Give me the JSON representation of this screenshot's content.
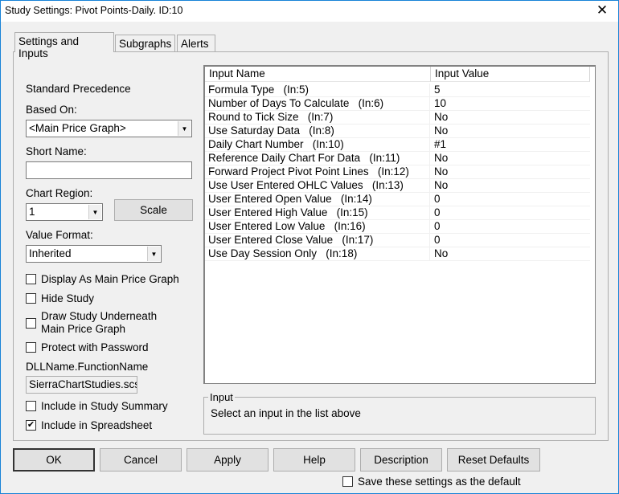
{
  "window": {
    "title": "Study Settings: Pivot Points-Daily. ID:10",
    "close": "✕"
  },
  "tabs": [
    "Settings and Inputs",
    "Subgraphs",
    "Alerts"
  ],
  "left": {
    "standard_precedence": "Standard Precedence",
    "based_on_label": "Based On:",
    "based_on_value": "<Main Price Graph>",
    "short_name_label": "Short Name:",
    "short_name_value": "",
    "chart_region_label": "Chart Region:",
    "chart_region_value": "1",
    "scale_button": "Scale",
    "value_format_label": "Value Format:",
    "value_format_value": "Inherited",
    "checkboxes": [
      {
        "label": "Display As Main Price Graph",
        "checked": false
      },
      {
        "label": "Hide Study",
        "checked": false
      },
      {
        "label": "Draw Study Underneath\nMain Price Graph",
        "checked": false
      },
      {
        "label": "Protect with Password",
        "checked": false
      }
    ],
    "dll_label": "DLLName.FunctionName",
    "dll_value": "SierraChartStudies.scs",
    "checkboxes2": [
      {
        "label": "Include in Study Summary",
        "checked": false
      },
      {
        "label": "Include in Spreadsheet",
        "checked": true
      }
    ]
  },
  "table": {
    "headers": [
      "Input Name",
      "Input Value"
    ],
    "rows": [
      [
        "Formula Type   (In:5)",
        "5"
      ],
      [
        "Number of Days To Calculate   (In:6)",
        "10"
      ],
      [
        "Round to Tick Size   (In:7)",
        "No"
      ],
      [
        "Use Saturday Data   (In:8)",
        "No"
      ],
      [
        "Daily Chart Number   (In:10)",
        "#1"
      ],
      [
        "Reference Daily Chart For Data   (In:11)",
        "No"
      ],
      [
        "Forward Project Pivot Point Lines   (In:12)",
        "No"
      ],
      [
        "Use User Entered OHLC Values   (In:13)",
        "No"
      ],
      [
        "User Entered Open Value   (In:14)",
        "0"
      ],
      [
        "User Entered High Value   (In:15)",
        "0"
      ],
      [
        "User Entered Low Value   (In:16)",
        "0"
      ],
      [
        "User Entered Close Value   (In:17)",
        "0"
      ],
      [
        "Use Day Session Only   (In:18)",
        "No"
      ]
    ]
  },
  "input_group": {
    "label": "Input",
    "text": "Select an input in the list above"
  },
  "buttons": [
    "OK",
    "Cancel",
    "Apply",
    "Help",
    "Description",
    "Reset Defaults"
  ],
  "save_default": {
    "label": "Save these settings as the default",
    "checked": false
  }
}
